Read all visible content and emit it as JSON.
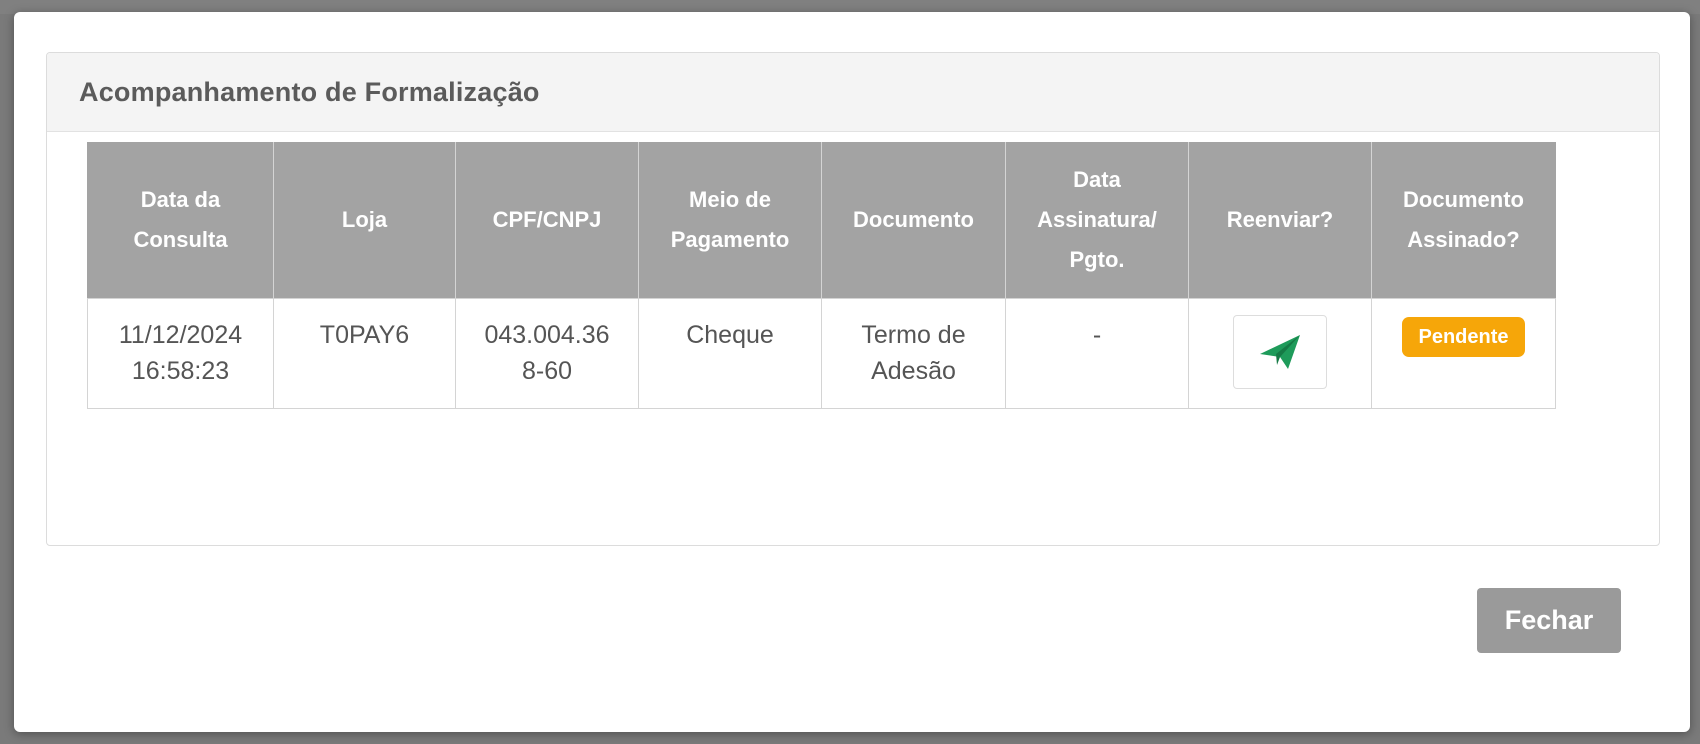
{
  "modal": {
    "title": "Acompanhamento de Formalização",
    "close_label": "Fechar"
  },
  "table": {
    "headers": [
      "Data da\nConsulta",
      "Loja",
      "CPF/CNPJ",
      "Meio de\nPagamento",
      "Documento",
      "Data\nAssinatura/\nPgto.",
      "Reenviar?",
      "Documento\nAssinado?"
    ],
    "rows": [
      {
        "data_consulta": "11/12/2024\n16:58:23",
        "loja": "T0PAY6",
        "cpf_cnpj": "043.004.36\n8-60",
        "meio_pagamento": "Cheque",
        "documento": "Termo de\nAdesão",
        "data_assinatura": "-",
        "reenviar_icon": "paper-plane-icon",
        "status": "Pendente"
      }
    ]
  },
  "colors": {
    "header_bg": "#a3a3a3",
    "send_icon": "#1e9b5a",
    "pending_badge": "#f6a609",
    "close_button": "#9a9a9a"
  }
}
